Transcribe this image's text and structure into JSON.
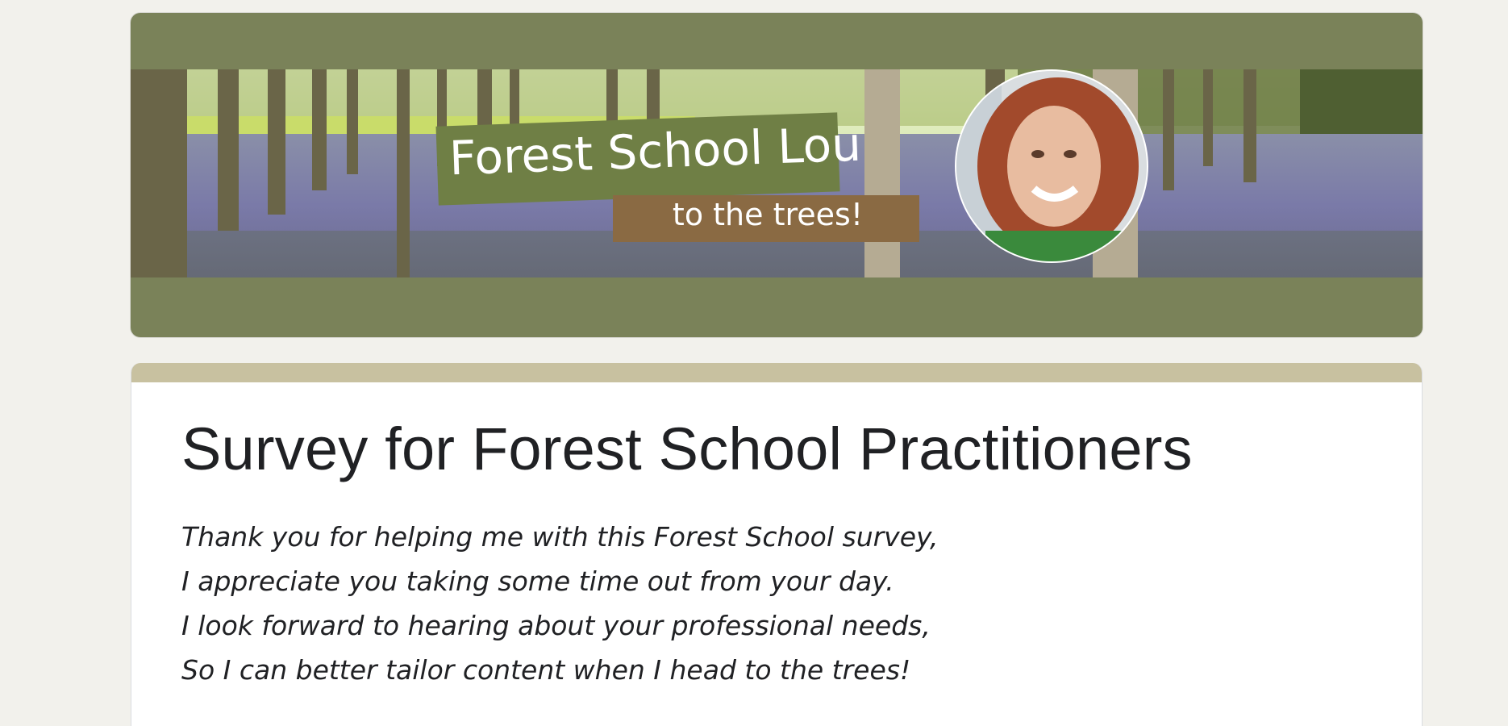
{
  "banner": {
    "logo_title": "Forest School Lou",
    "logo_tagline": "to the trees!"
  },
  "form": {
    "title": "Survey for Forest School Practitioners",
    "description_lines": [
      "Thank you for helping me with this Forest School survey,",
      "I appreciate you taking some time out from your day.",
      "I look forward to hearing about your professional needs,",
      "So I can better tailor content when I head to the trees!"
    ]
  },
  "colors": {
    "page_background": "#f2f1ec",
    "header_theme": "#7a8259",
    "card_accent": "#c8c1a0",
    "logo_green": "#6f7f45",
    "logo_brown": "#8a6a43"
  }
}
